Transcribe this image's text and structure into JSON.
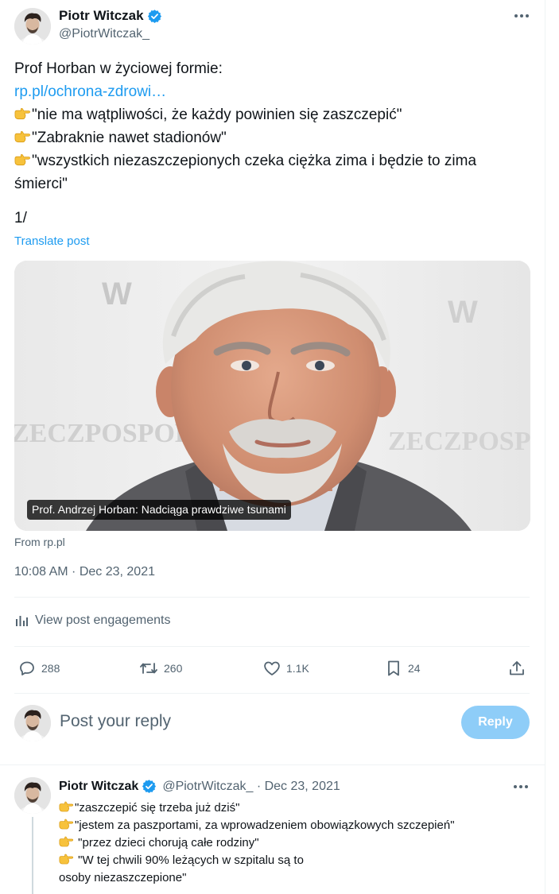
{
  "author": {
    "name": "Piotr Witczak",
    "handle": "@PiotrWitczak_"
  },
  "tweet": {
    "intro": "Prof Horban w życiowej formie:",
    "link": "rp.pl/ochrona-zdrowi…",
    "quotes": [
      "\"nie ma wątpliwości, że każdy powinien się zaszczepić\"",
      "\"Zabraknie nawet stadionów\"",
      "\"wszystkich niezaszczepionych czeka ciężka zima i będzie to zima śmierci\""
    ],
    "counter": "1/",
    "translate_label": "Translate post",
    "card_caption": "Prof. Andrzej Horban: Nadciąga prawdziwe tsunami",
    "card_source": "From rp.pl",
    "timestamp": "10:08 AM · Dec 23, 2021",
    "engagements_label": "View post engagements"
  },
  "actions": {
    "replies": "288",
    "reposts": "260",
    "likes": "1.1K",
    "bookmarks": "24"
  },
  "reply_box": {
    "placeholder": "Post your reply",
    "button_label": "Reply"
  },
  "reply_tweet": {
    "name": "Piotr Witczak",
    "meta": "@PiotrWitczak_ · Dec 23, 2021",
    "lines": [
      "\"zaszczepić się trzeba już dziś\"",
      "\"jestem za paszportami, za wprowadzeniem obowiązkowych szczepień\"",
      " \"przez dzieci chorują całe rodziny\"",
      " \"W tej chwili 90% leżących w szpitalu są to",
      "osoby niezaszczepione\""
    ]
  },
  "colors": {
    "accent": "#1d9bf0",
    "reply_button_disabled": "#8ecdf8",
    "secondary_text": "#536471",
    "primary_text": "#0f1419",
    "divider": "#eff3f4"
  },
  "icons": [
    "verified-badge-icon",
    "more-icon",
    "pointing-hand-emoji",
    "analytics-icon",
    "reply-icon",
    "repost-icon",
    "like-icon",
    "bookmark-icon",
    "share-icon"
  ]
}
